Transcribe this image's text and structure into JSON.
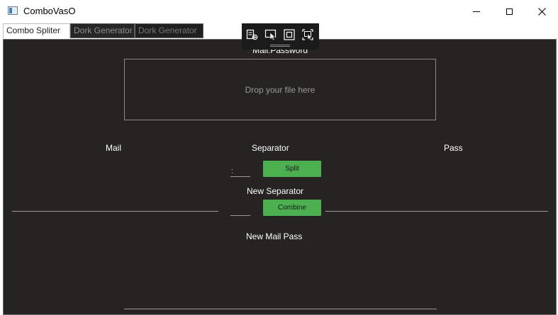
{
  "window": {
    "title": "ComboVasO"
  },
  "tabs": [
    {
      "label": "Combo Spliter"
    },
    {
      "label": "Dork Generator"
    },
    {
      "label": "Dork Generator"
    }
  ],
  "debug_toolbar": {
    "icons": [
      "live-visual-tree-icon",
      "select-element-icon",
      "display-layout-adorners-icon",
      "track-focused-element-icon"
    ]
  },
  "main": {
    "input_header": "Mail:Password",
    "dropzone_text": "Drop your file here",
    "mail_label": "Mail",
    "separator_label": "Separator",
    "pass_label": "Pass",
    "separator_value": ":",
    "split_label": "Split",
    "new_separator_label": "New Separator",
    "new_separator_value": "",
    "combine_label": "Combine",
    "new_mail_pass_label": "New Mail Pass"
  }
}
